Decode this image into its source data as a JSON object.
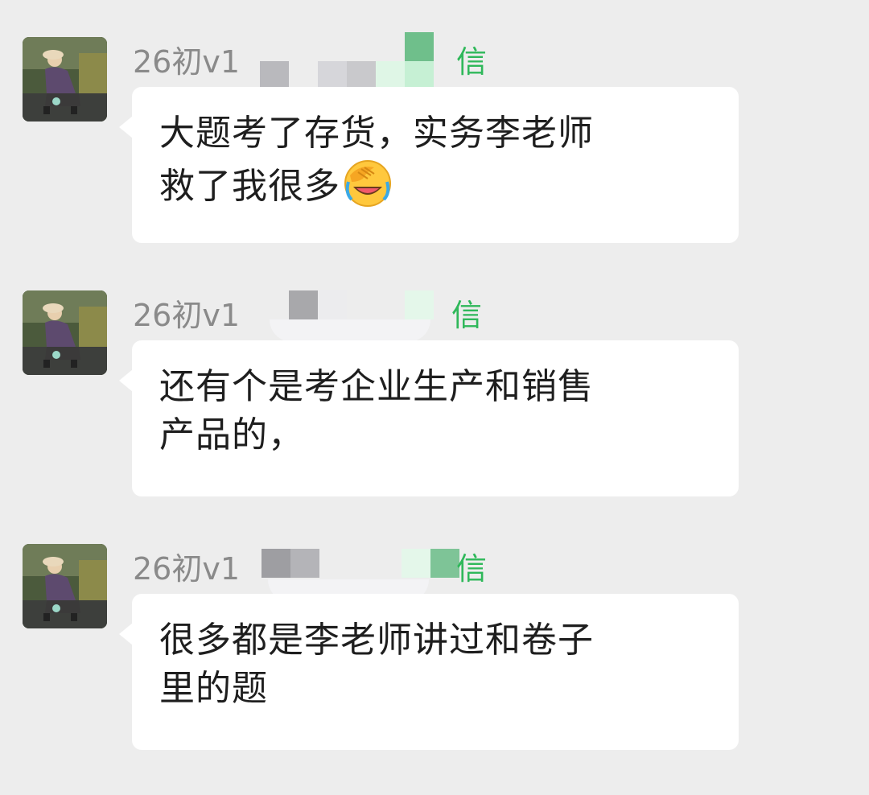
{
  "messages": [
    {
      "sender_name": "26初v1",
      "sender_tail": "信",
      "lines": [
        "大题考了存货，实务李老师",
        "救了我很多"
      ],
      "emoji": "face-palm-laughing-emoji"
    },
    {
      "sender_name": "26初v1",
      "sender_tail": "信",
      "lines": [
        "还有个是考企业生产和销售",
        "产品的，"
      ],
      "emoji": null
    },
    {
      "sender_name": "26初v1",
      "sender_tail": "信",
      "lines": [
        "很多都是李老师讲过和卷子",
        "里的题"
      ],
      "emoji": null
    }
  ],
  "colors": {
    "background": "#ededed",
    "bubble": "#ffffff",
    "sender_name": "#8a8a8a",
    "sender_tail": "#2fb85a",
    "text": "#1e1e1e"
  }
}
